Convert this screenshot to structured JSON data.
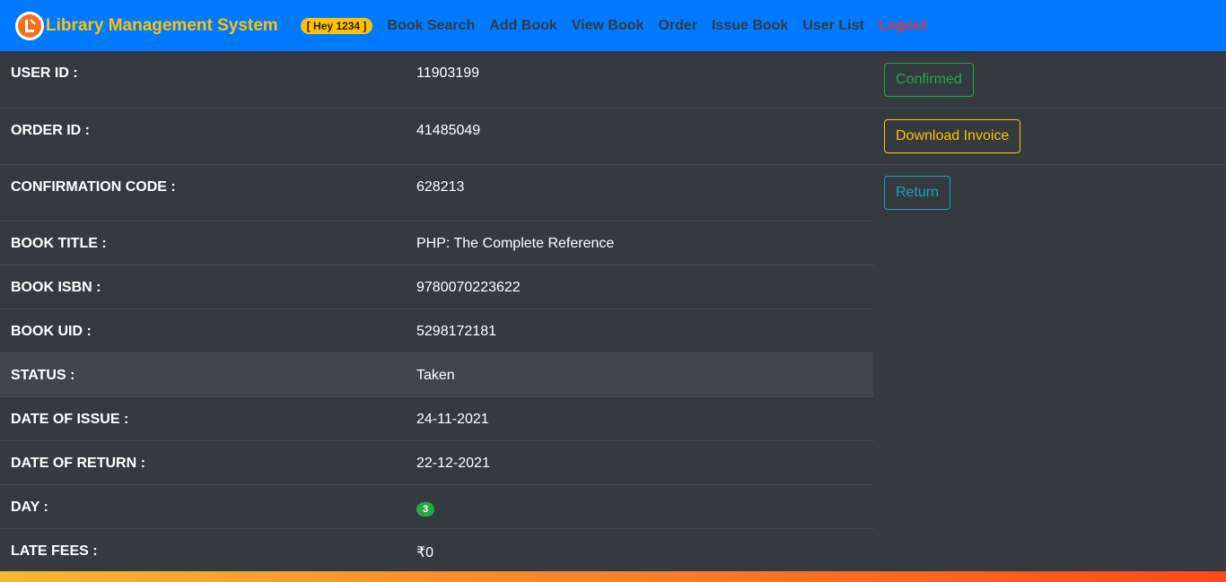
{
  "nav": {
    "brand": "Library Management System",
    "greeting": "[ Hey 1234 ]",
    "links": [
      "Book Search",
      "Add Book",
      "View Book",
      "Order",
      "Issue Book",
      "User List"
    ],
    "logout": "Logout"
  },
  "details": {
    "user_id": {
      "label": "USER ID :",
      "value": "11903199"
    },
    "order_id": {
      "label": "ORDER ID :",
      "value": "41485049"
    },
    "confirmation_code": {
      "label": "CONFIRMATION CODE :",
      "value": "628213"
    },
    "book_title": {
      "label": "BOOK TITLE :",
      "value": "PHP: The Complete Reference"
    },
    "book_isbn": {
      "label": "BOOK ISBN :",
      "value": "9780070223622"
    },
    "book_uid": {
      "label": "BOOK UID :",
      "value": "5298172181"
    },
    "status": {
      "label": "STATUS :",
      "value": "Taken"
    },
    "date_of_issue": {
      "label": "DATE OF ISSUE :",
      "value": "24-11-2021"
    },
    "date_of_return": {
      "label": "DATE OF RETURN :",
      "value": "22-12-2021"
    },
    "day": {
      "label": "DAY :",
      "value": "3"
    },
    "late_fees": {
      "label": "LATE FEES :",
      "value": "₹0"
    }
  },
  "actions": {
    "confirmed": "Confirmed",
    "download_invoice": "Download Invoice",
    "return": "Return"
  },
  "colors": {
    "navbar": "#007bff",
    "accent": "#ffc107",
    "success": "#28a745",
    "danger": "#dc3545",
    "info": "#17a2b8"
  }
}
